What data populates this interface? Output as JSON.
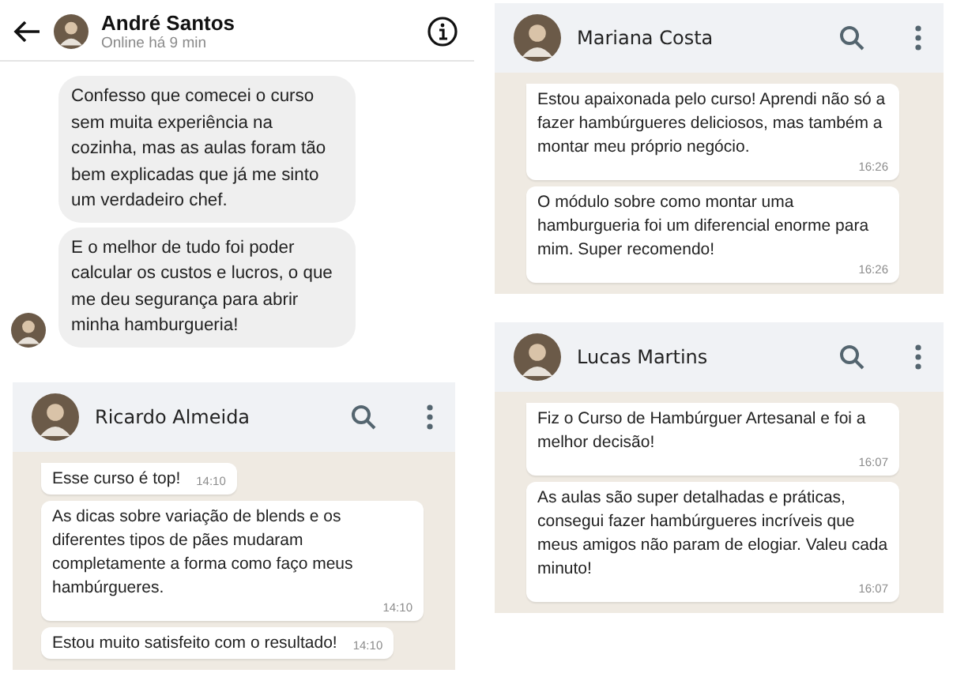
{
  "chats": [
    {
      "kind": "messenger",
      "name": "André Santos",
      "status": "Online há 9 min",
      "messages": [
        {
          "text": "Confesso que comecei o curso sem muita experiência na cozinha, mas as aulas foram tão bem explicadas que já me sinto um verdadeiro chef."
        },
        {
          "text": "E o melhor de tudo foi poder calcular os custos e lucros, o que me deu segurança para abrir minha hamburgueria!"
        }
      ]
    },
    {
      "kind": "whatsapp",
      "name": "Ricardo Almeida",
      "messages": [
        {
          "text": "Esse curso é top!",
          "time": "14:10"
        },
        {
          "text": "As dicas sobre variação de blends e os diferentes tipos de pães mudaram completamente a forma como faço meus hambúrgueres.",
          "time": "14:10"
        },
        {
          "text": "Estou muito satisfeito com o resultado!",
          "time": "14:10"
        }
      ]
    },
    {
      "kind": "whatsapp",
      "name": "Mariana Costa",
      "messages": [
        {
          "text": "Estou apaixonada pelo curso! Aprendi não só a fazer hambúrgueres deliciosos, mas também a montar meu próprio negócio.",
          "time": "16:26"
        },
        {
          "text": "O módulo sobre como montar uma hamburgueria foi um diferencial enorme para mim. Super recomendo!",
          "time": "16:26"
        }
      ]
    },
    {
      "kind": "whatsapp",
      "name": "Lucas Martins",
      "messages": [
        {
          "text": "Fiz o Curso de Hambúrguer Artesanal e foi a melhor decisão!",
          "time": "16:07"
        },
        {
          "text": "As aulas são super detalhadas e práticas, consegui fazer hambúrgueres incríveis que meus amigos não param de elogiar. Valeu cada minuto!",
          "time": "16:07"
        }
      ]
    }
  ]
}
